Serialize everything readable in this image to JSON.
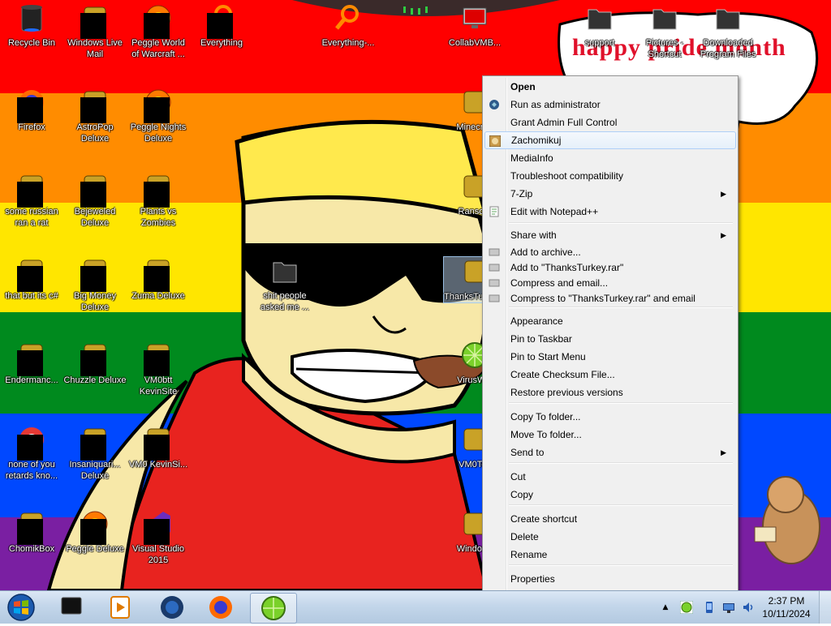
{
  "wallpaper": {
    "stripe_colors": [
      "#ff0000",
      "#ff8c00",
      "#ffe600",
      "#008a1e",
      "#0048ff",
      "#7a1fa2"
    ],
    "speech_text": "happy pride month"
  },
  "desktop_icons": [
    {
      "label": "Recycle Bin",
      "icon": "recycle-bin-icon"
    },
    {
      "label": "Windows Live Mail",
      "icon": "mail-icon"
    },
    {
      "label": "Peggle World of Warcraft ...",
      "icon": "peggle-icon"
    },
    {
      "label": "Everything",
      "icon": "search-icon"
    },
    {
      "label": "Everything-...",
      "icon": "search-icon"
    },
    {
      "label": "CollabVMB...",
      "icon": "monitor-icon"
    },
    {
      "label": "support",
      "icon": "folder-icon"
    },
    {
      "label": "Pictures - Shortcut",
      "icon": "folder-icon"
    },
    {
      "label": "Downloaded Program Files",
      "icon": "folder-icon"
    },
    {
      "label": "Firefox",
      "icon": "firefox-icon"
    },
    {
      "label": "AstroPop Deluxe",
      "icon": "game-icon"
    },
    {
      "label": "Peggle Nights Deluxe",
      "icon": "peggle-icon"
    },
    {
      "label": "Minecraft",
      "icon": "minecraft-icon"
    },
    {
      "label": "some russian ran a rat",
      "icon": "premiere-icon"
    },
    {
      "label": "Bejeweled Deluxe",
      "icon": "gem-icon"
    },
    {
      "label": "Plants vs Zombies",
      "icon": "plant-icon"
    },
    {
      "label": "Ransom",
      "icon": "skull-icon"
    },
    {
      "label": "that but its c#",
      "icon": "window-icon"
    },
    {
      "label": "Big Money Deluxe",
      "icon": "money-icon"
    },
    {
      "label": "Zuma Deluxe",
      "icon": "zuma-icon"
    },
    {
      "label": "shit people asked me ...",
      "icon": "folder-icon"
    },
    {
      "label": "ThanksTurkey.exe",
      "icon": "turkey-icon"
    },
    {
      "label": "Endermanc...",
      "icon": "terminal-icon"
    },
    {
      "label": "Chuzzle Deluxe",
      "icon": "chuzzle-icon"
    },
    {
      "label": "VM0btt KevinSite",
      "icon": "file-icon"
    },
    {
      "label": "VirusWin",
      "icon": "lime-icon"
    },
    {
      "label": "none of you retards kno...",
      "icon": "chrome-icon"
    },
    {
      "label": "Insaniquari... Deluxe",
      "icon": "fish-icon"
    },
    {
      "label": "VM0 KevinSi...",
      "icon": "file-icon"
    },
    {
      "label": "VM0Tec",
      "icon": "doctor-icon"
    },
    {
      "label": "ChomikBox",
      "icon": "hamster-box-icon"
    },
    {
      "label": "Peggle Deluxe",
      "icon": "peggle-icon"
    },
    {
      "label": "Visual Studio 2015",
      "icon": "visual-studio-icon"
    },
    {
      "label": "Windows",
      "icon": "update-icon"
    }
  ],
  "context_menu": {
    "items": [
      {
        "label": "Open",
        "bold": true
      },
      {
        "label": "Run as administrator",
        "icon": "shield-icon"
      },
      {
        "label": "Grant Admin Full Control"
      },
      {
        "label": "Zachomikuj",
        "icon": "chomikuj-icon"
      },
      {
        "label": "MediaInfo"
      },
      {
        "label": "Troubleshoot compatibility"
      },
      {
        "label": "7-Zip",
        "submenu": true
      },
      {
        "label": "Edit with Notepad++",
        "icon": "notepad-icon"
      },
      {
        "label": "Share with",
        "submenu": true
      },
      {
        "label": "Add to archive...",
        "icon": "archive-icon"
      },
      {
        "label": "Add to \"ThanksTurkey.rar\"",
        "icon": "archive-icon"
      },
      {
        "label": "Compress and email...",
        "icon": "archive-icon"
      },
      {
        "label": "Compress to \"ThanksTurkey.rar\" and email",
        "icon": "archive-icon"
      },
      {
        "label": "Appearance"
      },
      {
        "label": "Pin to Taskbar"
      },
      {
        "label": "Pin to Start Menu"
      },
      {
        "label": "Create Checksum File..."
      },
      {
        "label": "Restore previous versions"
      },
      {
        "label": "Copy To folder..."
      },
      {
        "label": "Move To folder..."
      },
      {
        "label": "Send to",
        "submenu": true
      },
      {
        "label": "Cut"
      },
      {
        "label": "Copy"
      },
      {
        "label": "Create shortcut"
      },
      {
        "label": "Delete"
      },
      {
        "label": "Rename"
      },
      {
        "label": "Properties"
      }
    ],
    "submenu_glyph": "▶"
  },
  "taskbar": {
    "pinned": [
      {
        "icon": "terminal-icon"
      },
      {
        "icon": "media-player-icon"
      },
      {
        "icon": "globe-icon"
      },
      {
        "icon": "firefox-icon"
      },
      {
        "icon": "lime-icon",
        "active": true
      }
    ],
    "tray": [
      "show-hidden-icons-icon",
      "lime-tray-icon",
      "phone-icon",
      "network-icon",
      "volume-icon"
    ],
    "clock_time": "2:37 PM",
    "clock_date": "10/11/2024",
    "tray_arrow": "▲"
  }
}
